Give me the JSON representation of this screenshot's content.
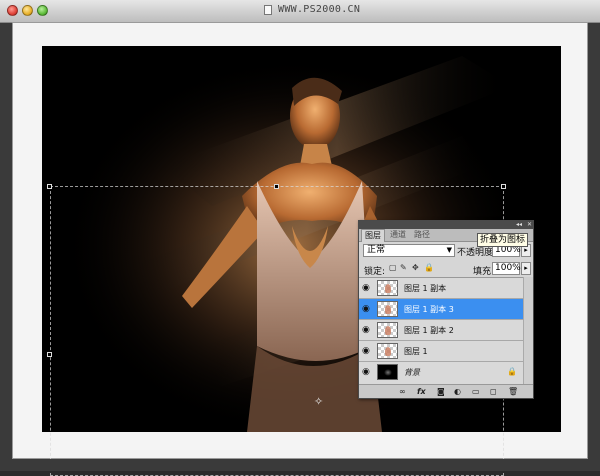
{
  "window": {
    "title": "WWW.PS2000.CN"
  },
  "layers_panel": {
    "tabs": [
      {
        "label": "图层"
      },
      {
        "label": "通道"
      },
      {
        "label": "路径"
      }
    ],
    "tooltip": "折叠为图标",
    "blend_mode": "正常",
    "opacity_label": "不透明度:",
    "opacity_value": "100%",
    "lock_label": "锁定:",
    "fill_label": "填充:",
    "fill_value": "100%",
    "layers": [
      {
        "name": "图层 1 副本",
        "selected": false,
        "thumb": "figure"
      },
      {
        "name": "图层 1 副本 3",
        "selected": true,
        "thumb": "figure"
      },
      {
        "name": "图层 1 副本 2",
        "selected": false,
        "thumb": "figure"
      },
      {
        "name": "图层 1",
        "selected": false,
        "thumb": "figure"
      },
      {
        "name": "背景",
        "selected": false,
        "thumb": "dark",
        "locked": true
      }
    ],
    "icons": [
      "eye-icon",
      "lock-icon",
      "link-icon",
      "fx-icon",
      "mask-icon",
      "adjustment-icon",
      "folder-icon",
      "new-layer-icon",
      "trash-icon"
    ]
  },
  "colors": {
    "selection_highlight": "#3b8ff0",
    "canvas_background": "#000000"
  }
}
